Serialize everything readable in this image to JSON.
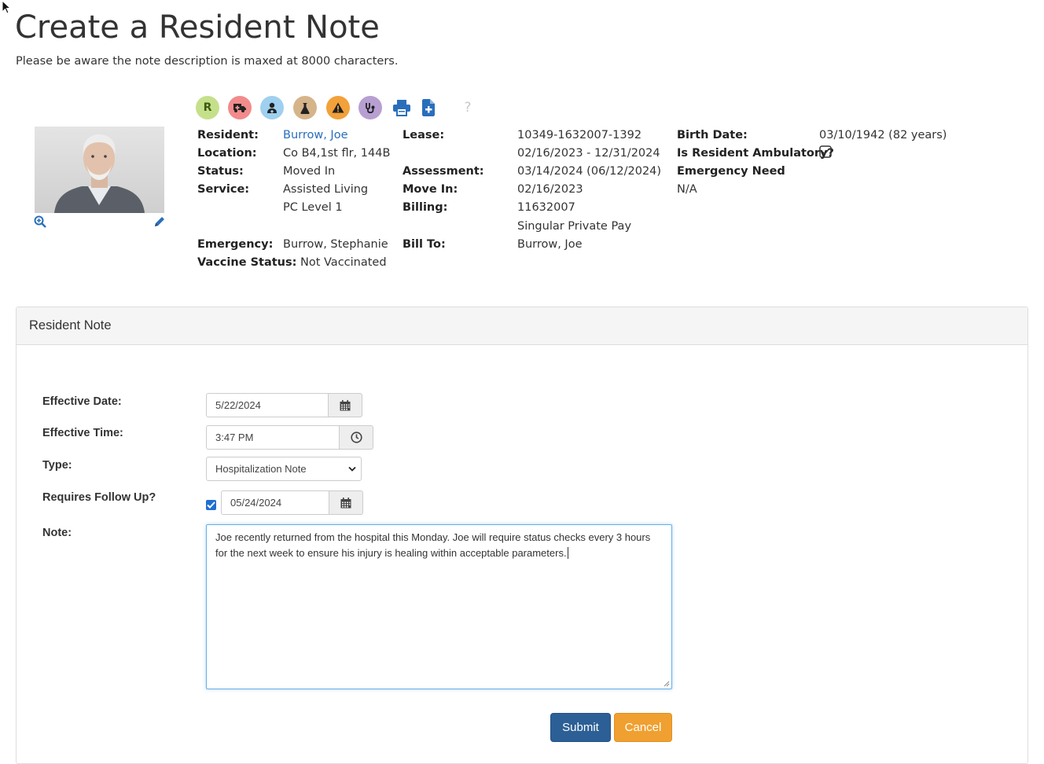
{
  "page": {
    "title": "Create a Resident Note",
    "subtitle": "Please be aware the note description is maxed at 8000 characters."
  },
  "quick_icons": [
    {
      "name": "resident-r-icon",
      "label": "R",
      "bg": "#c5e08a",
      "fg": "#3d5a10"
    },
    {
      "name": "ambulance-icon",
      "bg": "#f28b8b"
    },
    {
      "name": "doctor-icon",
      "bg": "#9fd0ef"
    },
    {
      "name": "lab-flask-icon",
      "bg": "#d6b48a"
    },
    {
      "name": "warning-icon",
      "bg": "#f3a13a"
    },
    {
      "name": "stethoscope-icon",
      "bg": "#b79fd2"
    },
    {
      "name": "print-icon",
      "color": "#2a6ebb"
    },
    {
      "name": "add-document-icon",
      "color": "#2a6ebb"
    },
    {
      "name": "help-icon",
      "label": "?",
      "color": "#c8c8c8"
    }
  ],
  "resident": {
    "labels": {
      "resident": "Resident:",
      "location": "Location:",
      "status": "Status:",
      "service": "Service:",
      "emergency": "Emergency:",
      "vaccine_status": "Vaccine Status:",
      "lease": "Lease:",
      "assessment": "Assessment:",
      "move_in": "Move In:",
      "billing": "Billing:",
      "bill_to": "Bill To:",
      "birth_date": "Birth Date:",
      "ambulatory": "Is Resident Ambulatory?",
      "emergency_need": "Emergency Need"
    },
    "name": "Burrow, Joe",
    "location": "Co B4,1st flr, 144B",
    "status": "Moved In",
    "service": "Assisted Living",
    "service_level": "PC Level 1",
    "emergency_contact": "Burrow, Stephanie",
    "vaccine_status": "Not Vaccinated",
    "lease_number": "10349-1632007-1392",
    "lease_dates": "02/16/2023 - 12/31/2024",
    "assessment": "03/14/2024 (06/12/2024)",
    "move_in": "02/16/2023",
    "billing_number": "11632007",
    "billing_plan": "Singular Private Pay",
    "bill_to": "Burrow, Joe",
    "birth_date": "03/10/1942 (82 years)",
    "ambulatory_checked": true,
    "emergency_need": "N/A"
  },
  "form": {
    "panel_title": "Resident Note",
    "effective_date_label": "Effective Date:",
    "effective_date": "5/22/2024",
    "effective_time_label": "Effective Time:",
    "effective_time": "3:47 PM",
    "type_label": "Type:",
    "type_value": "Hospitalization Note",
    "follow_up_label": "Requires Follow Up?",
    "follow_up_checked": true,
    "follow_up_date": "05/24/2024",
    "note_label": "Note:",
    "note_line1": "Joe recently returned from the hospital this Monday.  Joe will require status checks every 3 hours",
    "note_line2": "for the next week to ensure his injury is healing within acceptable parameters.",
    "submit_label": "Submit",
    "cancel_label": "Cancel"
  }
}
